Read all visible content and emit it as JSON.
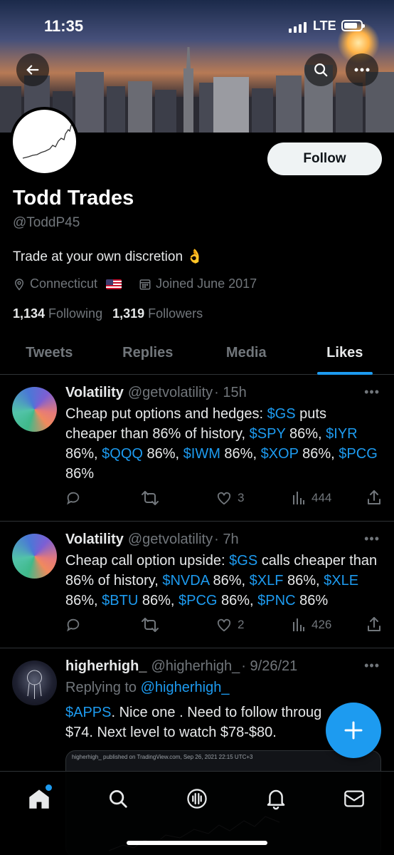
{
  "status_bar": {
    "time": "11:35",
    "network": "LTE"
  },
  "profile": {
    "name": "Todd Trades",
    "handle": "@ToddP45",
    "bio": "Trade at your own discretion 👌",
    "location": "Connecticut",
    "joined": "Joined June 2017",
    "following_count": "1,134",
    "following_label": "Following",
    "followers_count": "1,319",
    "followers_label": "Followers",
    "follow_button": "Follow"
  },
  "tabs": [
    {
      "label": "Tweets",
      "active": false
    },
    {
      "label": "Replies",
      "active": false
    },
    {
      "label": "Media",
      "active": false
    },
    {
      "label": "Likes",
      "active": true
    }
  ],
  "tweets": [
    {
      "name": "Volatility",
      "handle": "@getvolatility",
      "time": "· 15h",
      "body_parts": [
        {
          "text": "Cheap put options and hedges: "
        },
        {
          "text": "$GS",
          "link": true
        },
        {
          "text": " puts cheaper than 86% of history, "
        },
        {
          "text": "$SPY",
          "link": true
        },
        {
          "text": " 86%, "
        },
        {
          "text": "$IYR",
          "link": true
        },
        {
          "text": " 86%, "
        },
        {
          "text": "$QQQ",
          "link": true
        },
        {
          "text": " 86%, "
        },
        {
          "text": "$IWM",
          "link": true
        },
        {
          "text": " 86%, "
        },
        {
          "text": "$XOP",
          "link": true
        },
        {
          "text": " 86%, "
        },
        {
          "text": "$PCG",
          "link": true
        },
        {
          "text": " 86%"
        }
      ],
      "likes": "3",
      "views": "444"
    },
    {
      "name": "Volatility",
      "handle": "@getvolatility",
      "time": "· 7h",
      "body_parts": [
        {
          "text": "Cheap call option upside: "
        },
        {
          "text": "$GS",
          "link": true
        },
        {
          "text": " calls cheaper than 86% of history, "
        },
        {
          "text": "$NVDA",
          "link": true
        },
        {
          "text": " 86%, "
        },
        {
          "text": "$XLF",
          "link": true
        },
        {
          "text": " 86%, "
        },
        {
          "text": "$XLE",
          "link": true
        },
        {
          "text": " 86%, "
        },
        {
          "text": "$BTU",
          "link": true
        },
        {
          "text": " 86%, "
        },
        {
          "text": "$PCG",
          "link": true
        },
        {
          "text": " 86%, "
        },
        {
          "text": "$PNC",
          "link": true
        },
        {
          "text": " 86%"
        }
      ],
      "likes": "2",
      "views": "426"
    },
    {
      "name": "higherhigh_",
      "handle": "@higherhigh_",
      "time": "· 9/26/21",
      "replying_label": "Replying to",
      "replying_to": "@higherhigh_",
      "body_parts": [
        {
          "text": "$APPS",
          "link": true
        },
        {
          "text": ". Nice one . Need to follow throug"
        },
        {
          "text": "$74. Next level to watch $78-$80.",
          "newline": true
        }
      ],
      "image_caption": "higherhigh_ published on TradingView.com, Sep 26, 2021 22:15 UTC+3"
    }
  ],
  "colors": {
    "accent": "#1d9bf0",
    "background": "#000000",
    "muted": "#71767b"
  },
  "icons": {
    "back": "arrow-left-icon",
    "search": "search-icon",
    "more": "more-icon",
    "nav": [
      "home-icon",
      "search-icon",
      "spaces-icon",
      "notifications-icon",
      "messages-icon"
    ]
  }
}
